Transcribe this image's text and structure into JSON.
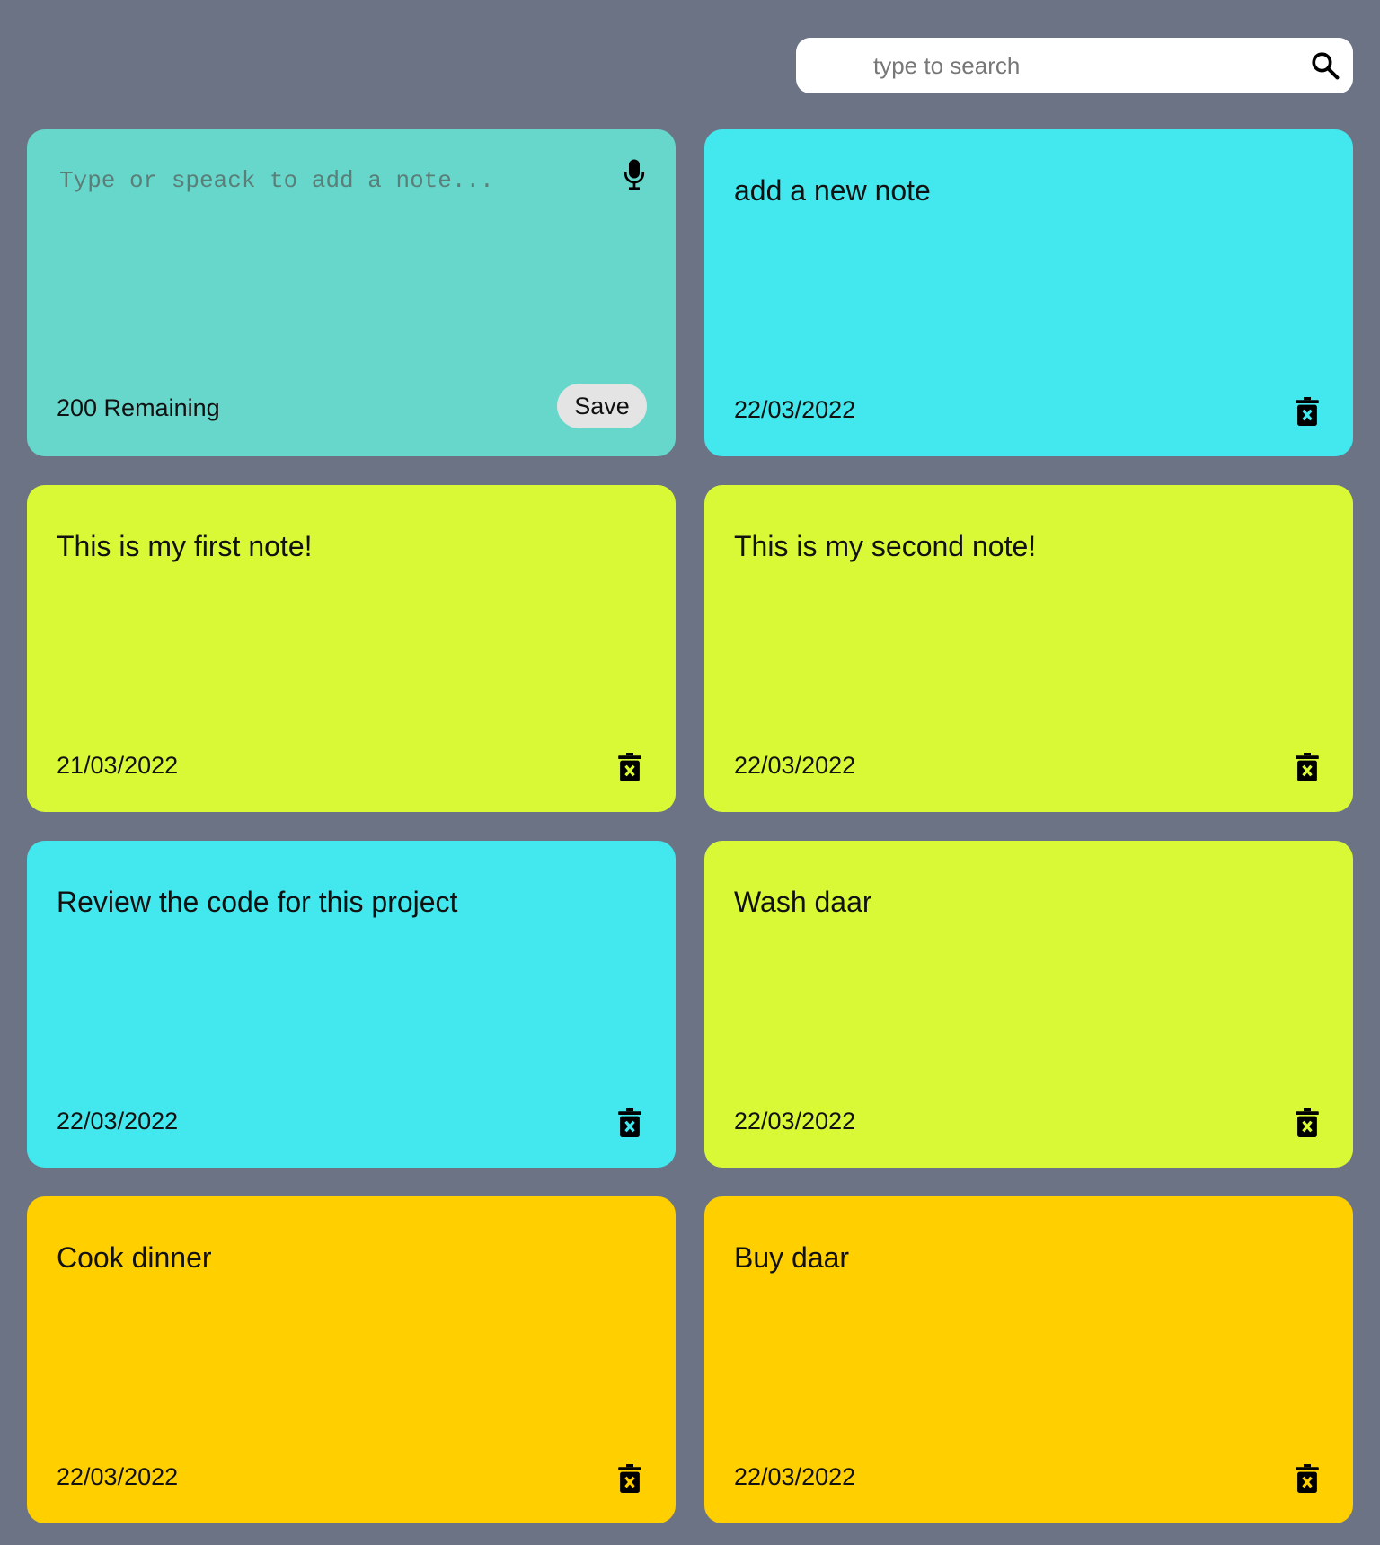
{
  "search": {
    "placeholder": "type to search",
    "value": "",
    "icon": "search-icon"
  },
  "new_note": {
    "placeholder": "Type or speack to add a note...",
    "value": "",
    "remaining_label": "200 Remaining",
    "save_label": "Save",
    "color": "#67d7cc",
    "icon": "microphone-icon"
  },
  "notes": [
    {
      "text": "add a new note",
      "date": "22/03/2022",
      "color": "#43e8ee"
    },
    {
      "text": "This is my first note!",
      "date": "21/03/2022",
      "color": "#d9f936"
    },
    {
      "text": "This is my second note!",
      "date": "22/03/2022",
      "color": "#d9f936"
    },
    {
      "text": "Review the code for this project",
      "date": "22/03/2022",
      "color": "#43e8ee"
    },
    {
      "text": "Wash daar",
      "date": "22/03/2022",
      "color": "#d9f936"
    },
    {
      "text": "Cook dinner",
      "date": "22/03/2022",
      "color": "#ffcf00"
    },
    {
      "text": "Buy daar",
      "date": "22/03/2022",
      "color": "#ffcf00"
    }
  ],
  "colors": {
    "background": "#6b7385"
  }
}
